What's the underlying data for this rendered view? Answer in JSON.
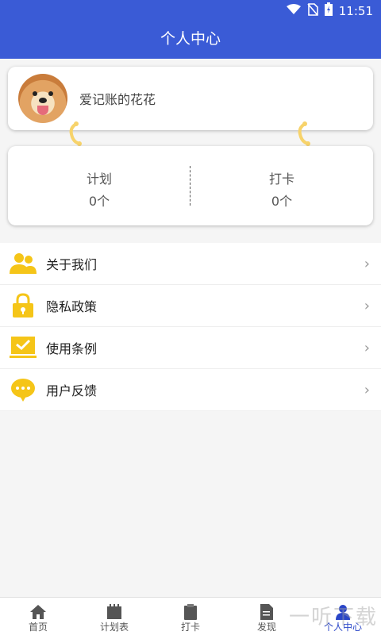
{
  "status_bar": {
    "time": "11:51"
  },
  "header": {
    "title": "个人中心"
  },
  "profile": {
    "name": "爱记账的花花"
  },
  "stats": [
    {
      "label": "计划",
      "count": "0个"
    },
    {
      "label": "打卡",
      "count": "0个"
    }
  ],
  "menu": [
    {
      "label": "关于我们",
      "icon": "users-icon"
    },
    {
      "label": "隐私政策",
      "icon": "lock-icon"
    },
    {
      "label": "使用条例",
      "icon": "laptop-check-icon"
    },
    {
      "label": "用户反馈",
      "icon": "chat-bubble-icon"
    }
  ],
  "tabs": [
    {
      "label": "首页",
      "icon": "home-icon"
    },
    {
      "label": "计划表",
      "icon": "calendar-icon"
    },
    {
      "label": "打卡",
      "icon": "clipboard-icon"
    },
    {
      "label": "发现",
      "icon": "document-icon"
    },
    {
      "label": "个人中心",
      "icon": "person-icon",
      "active": true
    }
  ],
  "watermark": "一听下载",
  "colors": {
    "primary": "#3a5bd6",
    "accent": "#f5c518",
    "tab_active": "#2a46c8"
  }
}
